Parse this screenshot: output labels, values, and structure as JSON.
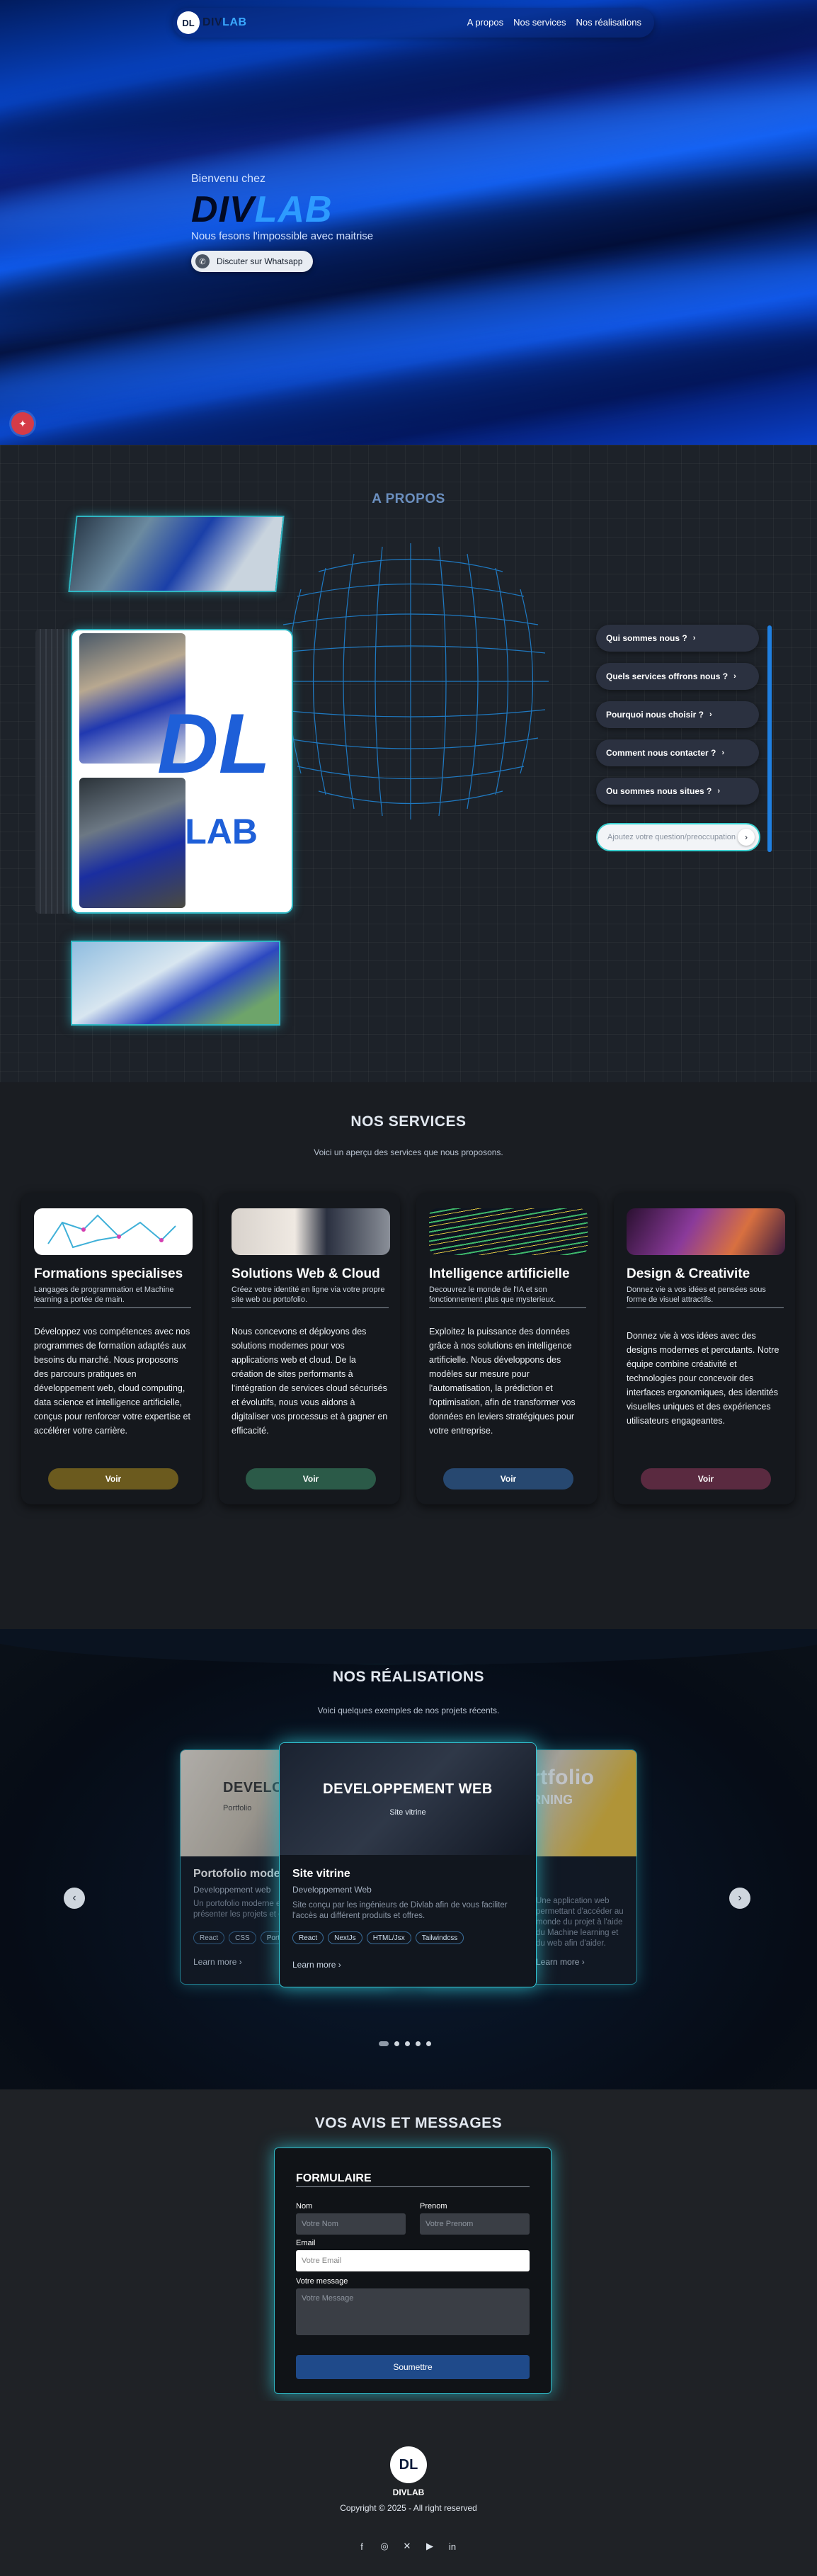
{
  "nav": {
    "logo_mark": "DL",
    "brand_prefix": "DIV",
    "brand_suffix": "LAB",
    "links": [
      "A propos",
      "Nos services",
      "Nos réalisations"
    ]
  },
  "hero": {
    "welcome": "Bienvenu chez",
    "brand_dark": "DIV",
    "brand_light": "LAB",
    "tagline": "Nous fesons l'impossible avec maitrise",
    "whatsapp_label": "Discuter sur Whatsapp",
    "fab_icon": "sparkle-icon"
  },
  "apropos": {
    "title": "A PROPOS",
    "logo_mark": "DL",
    "logo_text": "LAB",
    "faq": [
      "Qui sommes nous ?",
      "Quels services offrons nous ?",
      "Pourquoi nous choisir ?",
      "Comment nous contacter ?",
      "Ou sommes nous situes ?"
    ],
    "ask_placeholder": "Ajoutez votre question/preoccupation"
  },
  "services": {
    "title": "NOS SERVICES",
    "subtitle": "Voici un aperçu des services que nous proposons.",
    "cards": [
      {
        "title": "Formations specialises",
        "sub": "Langages de programmation et Machine learning a portée de main.",
        "desc": "Développez vos compétences avec nos programmes de formation adaptés aux besoins du marché. Nous proposons des parcours pratiques en développement web, cloud computing, data science et intelligence artificielle, conçus pour renforcer votre expertise et accélérer votre carrière.",
        "button": "Voir",
        "color": "#6b5a1e"
      },
      {
        "title": "Solutions Web & Cloud",
        "sub": "Créez votre identité en ligne via votre propre site web ou portofolio.",
        "desc": "Nous concevons et déployons des solutions modernes pour vos applications web et cloud. De la création de sites performants à l'intégration de services cloud sécurisés et évolutifs, nous vous aidons à digitaliser vos processus et à gagner en efficacité.",
        "button": "Voir",
        "color": "#2b5a48"
      },
      {
        "title": "Intelligence artificielle",
        "sub": "Decouvrez le monde de l'IA et son fonctionnement plus que mysterieux.",
        "desc": "Exploitez la puissance des données grâce à nos solutions en intelligence artificielle. Nous développons des modèles sur mesure pour l'automatisation, la prédiction et l'optimisation, afin de transformer vos données en leviers stratégiques pour votre entreprise.",
        "button": "Voir",
        "color": "#274870"
      },
      {
        "title": "Design & Creativite",
        "sub": "Donnez vie a vos idées et pensées sous forme de visuel attractifs.",
        "desc": "Donnez vie à vos idées avec des designs modernes et percutants. Notre équipe combine créativité et technologies pour concevoir des interfaces ergonomiques, des identités visuelles uniques et des expériences utilisateurs engageantes.",
        "button": "Voir",
        "color": "#5a2a40"
      }
    ]
  },
  "realisations": {
    "title": "NOS RÉALISATIONS",
    "subtitle": "Voici quelques exemples de nos projets récents.",
    "left": {
      "overlay": "DEVELO",
      "overlay_sub": "Portfolio",
      "title": "Portofolio mode",
      "category": "Developpement web",
      "desc": "Un portofolio moderne et responsive pour présenter les projets et compétences",
      "tags": [
        "React",
        "CSS",
        "Portfolio"
      ],
      "learn": "Learn more"
    },
    "main": {
      "overlay": "DEVELOPPEMENT WEB",
      "overlay_sub": "Site vitrine",
      "title": "Site vitrine",
      "category": "Developpement Web",
      "desc": "Site conçu par les ingénieurs de Divlab afin de vous faciliter l'accès au différent produits et offres.",
      "tags": [
        "React",
        "NextJs",
        "HTML/Jsx",
        "Tailwindcss"
      ],
      "learn": "Learn more"
    },
    "right": {
      "overlay": "rtfolio",
      "overlay_sub": "RNING",
      "desc": "Une application web permettant d'accéder au monde du projet à l'aide du Machine learning et du web afin d'aider.",
      "learn": "Learn more"
    },
    "prev_icon": "chevron-left-icon",
    "next_icon": "chevron-right-icon"
  },
  "avis": {
    "title": "VOS AVIS ET MESSAGES",
    "form_title": "FORMULAIRE",
    "nom_label": "Nom",
    "nom_placeholder": "Votre Nom",
    "prenom_label": "Prenom",
    "prenom_placeholder": "Votre Prenom",
    "email_label": "Email",
    "email_placeholder": "Votre Email",
    "message_label": "Votre message",
    "message_placeholder": "Votre Message",
    "submit": "Soumettre"
  },
  "footer": {
    "logo_mark": "DL",
    "brand": "DIVLAB",
    "copyright": "Copyright © 2025 - All right reserved",
    "socials": [
      "facebook-icon",
      "instagram-icon",
      "x-icon",
      "youtube-icon",
      "linkedin-icon"
    ]
  }
}
